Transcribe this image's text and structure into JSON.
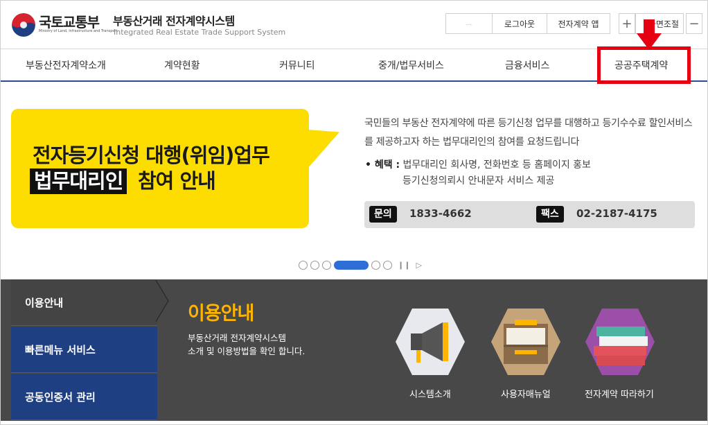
{
  "header": {
    "ministry_name": "국토교통부",
    "ministry_sub": "Ministry of Land, Infrastructure and Transport",
    "site_title": "부동산거래 전자계약시스템",
    "site_sub": "Integrated Real Estate Trade Support System",
    "util_blank": "...",
    "logout": "로그아웃",
    "app": "전자계약 앱",
    "zoom_in": "+",
    "zoom_label": "화면조절",
    "zoom_out": "−"
  },
  "nav": {
    "items": [
      {
        "label": "부동산전자계약소개"
      },
      {
        "label": "계약현황"
      },
      {
        "label": "커뮤니티"
      },
      {
        "label": "중개/법무서비스"
      },
      {
        "label": "금융서비스"
      },
      {
        "label": "공공주택계약"
      }
    ]
  },
  "banner": {
    "headline_line1": "전자등기신청 대행(위임)업무",
    "headline_dark": "법무대리인",
    "headline_line2": "참여 안내",
    "description": "국민들의 부동산 전자계약에 따른 등기신청 업무를 대행하고 등기수수료 할인서비스를 제공하고자 하는 법무대리인의 참여를 요청드립니다",
    "benefit_label": "• 혜택 :",
    "benefit_text1": "법무대리인 회사명, 전화번호 등 홈페이지 홍보",
    "benefit_text2": "등기신청의뢰시 안내문자 서비스 제공",
    "inquiry_tag": "문의",
    "inquiry_number": "1833-4662",
    "fax_tag": "팩스",
    "fax_number": "02-2187-4175",
    "slides": {
      "count": 6,
      "active": 4
    }
  },
  "left_menu": {
    "items": [
      {
        "label": "이용안내"
      },
      {
        "label": "빠른메뉴 서비스"
      },
      {
        "label": "공동인증서 관리"
      }
    ]
  },
  "section": {
    "title": "이용안내",
    "desc_line1": "부동산거래 전자계약시스템",
    "desc_line2": "소개 및 이용방법을 확인 합니다.",
    "tiles": [
      {
        "label": "시스템소개",
        "icon": "megaphone-icon"
      },
      {
        "label": "사용자매뉴얼",
        "icon": "folder-box-icon"
      },
      {
        "label": "전자계약 따라하기",
        "icon": "stacked-papers-icon"
      }
    ]
  },
  "colors": {
    "primary_blue": "#1e3f82",
    "highlight_red": "#e50012",
    "banner_yellow": "#fddc00",
    "section_gold": "#ffb400",
    "dot_active": "#2f6ed6"
  }
}
